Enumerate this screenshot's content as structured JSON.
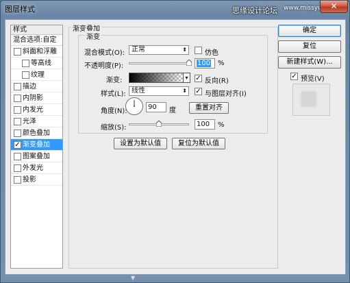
{
  "window": {
    "title": "图层样式",
    "watermark": "思缘设计论坛",
    "watermark_url": "www.missyuan.com",
    "close_glyph": "✕",
    "bottom_grip": "▼"
  },
  "styles_list": {
    "header": "样式",
    "blend_options": "混合选项:自定",
    "items": [
      {
        "label": "斜面和浮雕",
        "checked": false,
        "sub": false
      },
      {
        "label": "等高线",
        "checked": false,
        "sub": true
      },
      {
        "label": "纹理",
        "checked": false,
        "sub": true
      },
      {
        "label": "描边",
        "checked": false,
        "sub": false
      },
      {
        "label": "内阴影",
        "checked": false,
        "sub": false
      },
      {
        "label": "内发光",
        "checked": false,
        "sub": false
      },
      {
        "label": "光泽",
        "checked": false,
        "sub": false
      },
      {
        "label": "颜色叠加",
        "checked": false,
        "sub": false
      },
      {
        "label": "渐变叠加",
        "checked": true,
        "sub": false,
        "selected": true
      },
      {
        "label": "图案叠加",
        "checked": false,
        "sub": false
      },
      {
        "label": "外发光",
        "checked": false,
        "sub": false
      },
      {
        "label": "投影",
        "checked": false,
        "sub": false
      }
    ]
  },
  "panel": {
    "group_title": "渐变叠加",
    "sub_title": "渐变",
    "blend_mode_label": "混合模式(O):",
    "blend_mode_value": "正常",
    "dither_label": "仿色",
    "opacity_label": "不透明度(P):",
    "opacity_value": "100",
    "opacity_fraction": 1.0,
    "percent": "%",
    "gradient_label": "渐变:",
    "reverse_label": "反向(R)",
    "style_label": "样式(L):",
    "style_value": "线性",
    "align_label": "与图层对齐(I)",
    "angle_label": "角度(N):",
    "angle_value": "90",
    "degree_unit": "度",
    "reset_align_button": "重置对齐",
    "scale_label": "缩放(S):",
    "scale_value": "100",
    "scale_fraction": 0.5,
    "make_default_button": "设置为默认值",
    "reset_default_button": "复位为默认值",
    "checkbox_mark": "✓",
    "dropdown_arrow": "⬍",
    "swatch_arrow": "▾"
  },
  "right": {
    "ok_button": "确定",
    "reset_button": "复位",
    "new_style_button": "新建样式(W)...",
    "preview_label": "预览(V)"
  }
}
